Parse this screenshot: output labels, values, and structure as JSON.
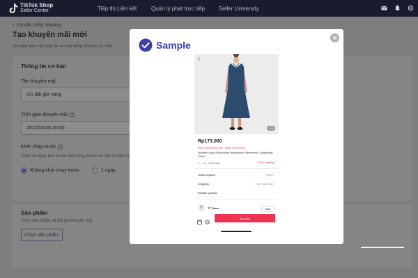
{
  "topbar": {
    "brand_line1": "TikTok Shop",
    "brand_line2": "Seller Center",
    "nav": [
      "Tiếp thị Liên kết",
      "Quản lý phát trực tiếp",
      "Seller University"
    ],
    "icons": [
      "mail-icon",
      "bell-icon",
      "settings-icon"
    ]
  },
  "page": {
    "back_label": "Ưu đãi chớp nhoáng",
    "title": "Tạo khuyến mãi mới",
    "subtitle": "Vui lòng xem các quy tắc ưu đãi chớp nhoáng và mẫu",
    "basic_info": {
      "title": "Thông tin cơ bản",
      "name_label": "Tên khuyến mãi",
      "name_value": "Ưu đãi giờ vàng",
      "time_label": "Thời gian khuyến mãi",
      "time_value": "2022/04/28 20:00",
      "warmup_label": "Khởi chạy trước",
      "warmup_hint": "Chọn số ngày bạn muốn khởi chạy trước ưu đãi sự kiện và",
      "options": [
        "Không khởi chạy trước",
        "1 ngày"
      ],
      "selected_option": "Không khởi chạy trước"
    },
    "products": {
      "title": "Sản phẩm",
      "hint": "Chọn sản phẩm và đặt giá khuyến mãi",
      "button": "Chọn sản phẩm"
    }
  },
  "modal": {
    "brand": "Sample",
    "product": {
      "price": "Rp173.000",
      "flash": "Flash Sale Rp162.000 · Starts in 01:00:00",
      "name": "Women's Navy Blue Indian Handwoven Sleeveless Comfortable Dress",
      "rating": "4.9",
      "sold": "100K sold",
      "shipping": "Free shipping",
      "image_counter": "1/4",
      "rows": [
        {
          "label": "Select options",
          "value": "Select"
        },
        {
          "label": "Shipping",
          "value": "From Rp10.000"
        },
        {
          "label": "Retailer policies",
          "value": ""
        }
      ],
      "store_name": "TT Store",
      "visit": "Visit",
      "buy": "Buy now"
    }
  },
  "colors": {
    "accent": "#3d3da8",
    "buy": "#ee3355",
    "topbar": "#1a1b2e"
  }
}
